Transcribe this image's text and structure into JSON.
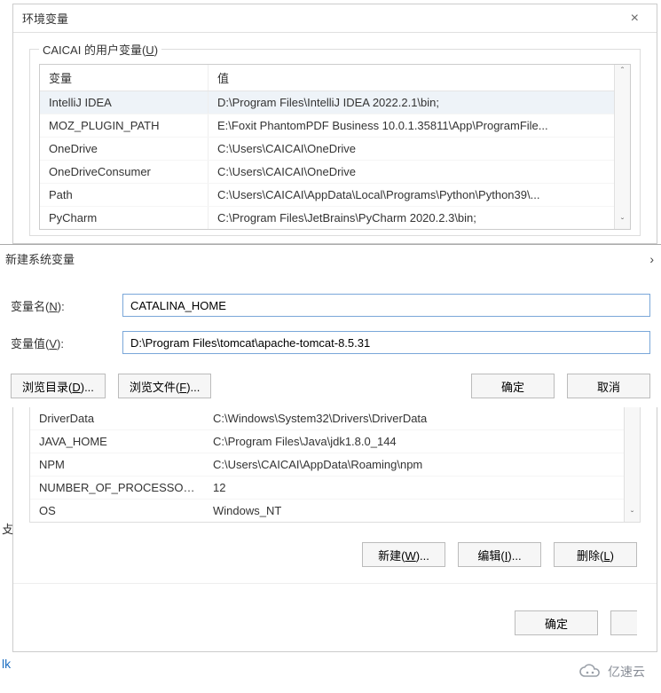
{
  "env_window": {
    "title": "环境变量",
    "close": "×",
    "user_vars_legend_prefix": "CAICAI 的用户变量(",
    "user_vars_legend_u": "U",
    "user_vars_legend_suffix": ")",
    "col_var": "变量",
    "col_val": "值",
    "user_rows": [
      {
        "var": "IntelliJ IDEA",
        "val": "D:\\Program Files\\IntelliJ IDEA 2022.2.1\\bin;"
      },
      {
        "var": "MOZ_PLUGIN_PATH",
        "val": "E:\\Foxit PhantomPDF Business 10.0.1.35811\\App\\ProgramFile..."
      },
      {
        "var": "OneDrive",
        "val": "C:\\Users\\CAICAI\\OneDrive"
      },
      {
        "var": "OneDriveConsumer",
        "val": "C:\\Users\\CAICAI\\OneDrive"
      },
      {
        "var": "Path",
        "val": "C:\\Users\\CAICAI\\AppData\\Local\\Programs\\Python\\Python39\\..."
      },
      {
        "var": "PyCharm",
        "val": "C:\\Program Files\\JetBrains\\PyCharm 2020.2.3\\bin;"
      }
    ],
    "up": "ˆ",
    "down": "ˇ"
  },
  "new_dialog": {
    "title": "新建系统变量",
    "chev": "›",
    "name_label_prefix": "变量名(",
    "name_label_u": "N",
    "name_label_suffix": "):",
    "name_value": "CATALINA_HOME",
    "value_label_prefix": "变量值(",
    "value_label_u": "V",
    "value_label_suffix": "):",
    "value_value": "D:\\Program Files\\tomcat\\apache-tomcat-8.5.31",
    "browse_dir_prefix": "浏览目录(",
    "browse_dir_u": "D",
    "browse_dir_suffix": ")...",
    "browse_file_prefix": "浏览文件(",
    "browse_file_u": "F",
    "browse_file_suffix": ")...",
    "ok": "确定",
    "cancel": "取消"
  },
  "sys_rows": [
    {
      "var": "DriverData",
      "val": "C:\\Windows\\System32\\Drivers\\DriverData"
    },
    {
      "var": "JAVA_HOME",
      "val": "C:\\Program Files\\Java\\jdk1.8.0_144"
    },
    {
      "var": "NPM",
      "val": "C:\\Users\\CAICAI\\AppData\\Roaming\\npm"
    },
    {
      "var": "NUMBER_OF_PROCESSORS",
      "val": "12"
    },
    {
      "var": "OS",
      "val": "Windows_NT"
    }
  ],
  "sys_buttons": {
    "new_prefix": "新建(",
    "new_u": "W",
    "new_suffix": ")...",
    "edit_prefix": "编辑(",
    "edit_u": "I",
    "edit_suffix": ")...",
    "del_prefix": "删除(",
    "del_u": "L",
    "del_suffix": ")"
  },
  "final": {
    "ok": "确定"
  },
  "side_text": {
    "lk": "lk",
    "g": "攴"
  },
  "watermark": "亿速云"
}
